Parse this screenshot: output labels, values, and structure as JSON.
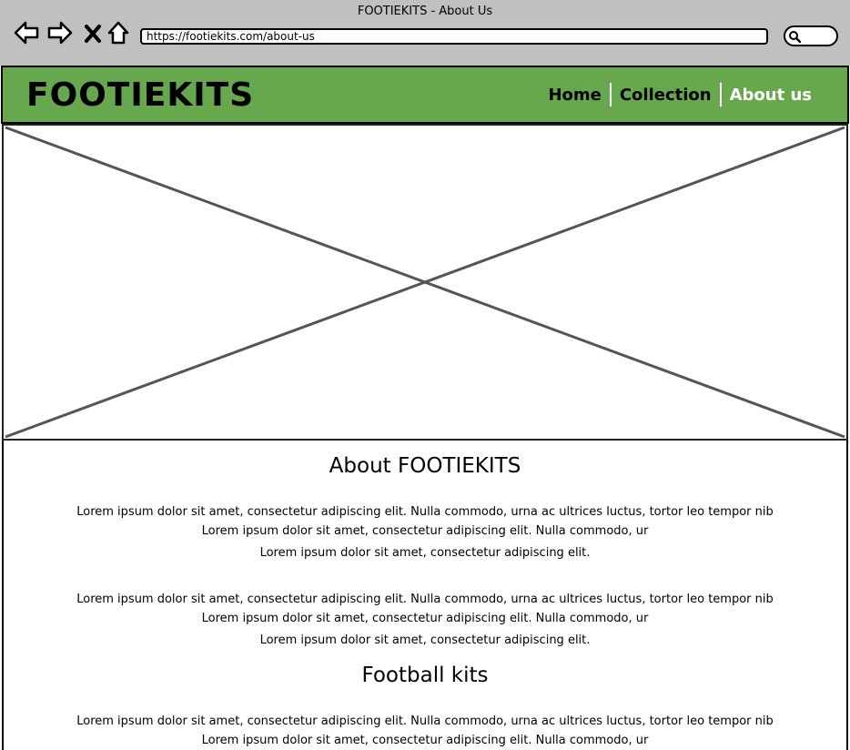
{
  "browser": {
    "title": "FOOTIEKITS - About Us",
    "url": "https://footiekits.com/about-us",
    "icons": [
      "back-icon",
      "forward-icon",
      "close-icon",
      "home-icon",
      "search-icon"
    ]
  },
  "site": {
    "logo": "FOOTIEKITS",
    "header_color": "#67a84e",
    "nav": [
      {
        "label": "Home"
      },
      {
        "label": "Collection"
      },
      {
        "label": "About us",
        "active": true
      }
    ]
  },
  "hero": {
    "icon": "image-placeholder-icon"
  },
  "content": {
    "about_heading": "About FOOTIEKITS",
    "about_paragraphs": [
      {
        "line1": "Lorem ipsum dolor sit amet, consectetur adipiscing elit. Nulla commodo, urna ac ultrices luctus, tortor leo tempor nib",
        "line2": "Lorem ipsum dolor sit amet, consectetur adipiscing elit. Nulla commodo, ur",
        "line3": "Lorem ipsum dolor sit amet, consectetur adipiscing elit."
      },
      {
        "line1": "Lorem ipsum dolor sit amet, consectetur adipiscing elit. Nulla commodo, urna ac ultrices luctus, tortor leo tempor nib",
        "line2": "Lorem ipsum dolor sit amet, consectetur adipiscing elit. Nulla commodo, ur",
        "line3": "Lorem ipsum dolor sit amet, consectetur adipiscing elit."
      }
    ],
    "kits_heading": "Football kits",
    "kits_paragraph": {
      "line1": "Lorem ipsum dolor sit amet, consectetur adipiscing elit. Nulla commodo, urna ac ultrices luctus, tortor leo tempor nib",
      "line2": "Lorem ipsum dolor sit amet, consectetur adipiscing elit. Nulla commodo, ur"
    }
  }
}
